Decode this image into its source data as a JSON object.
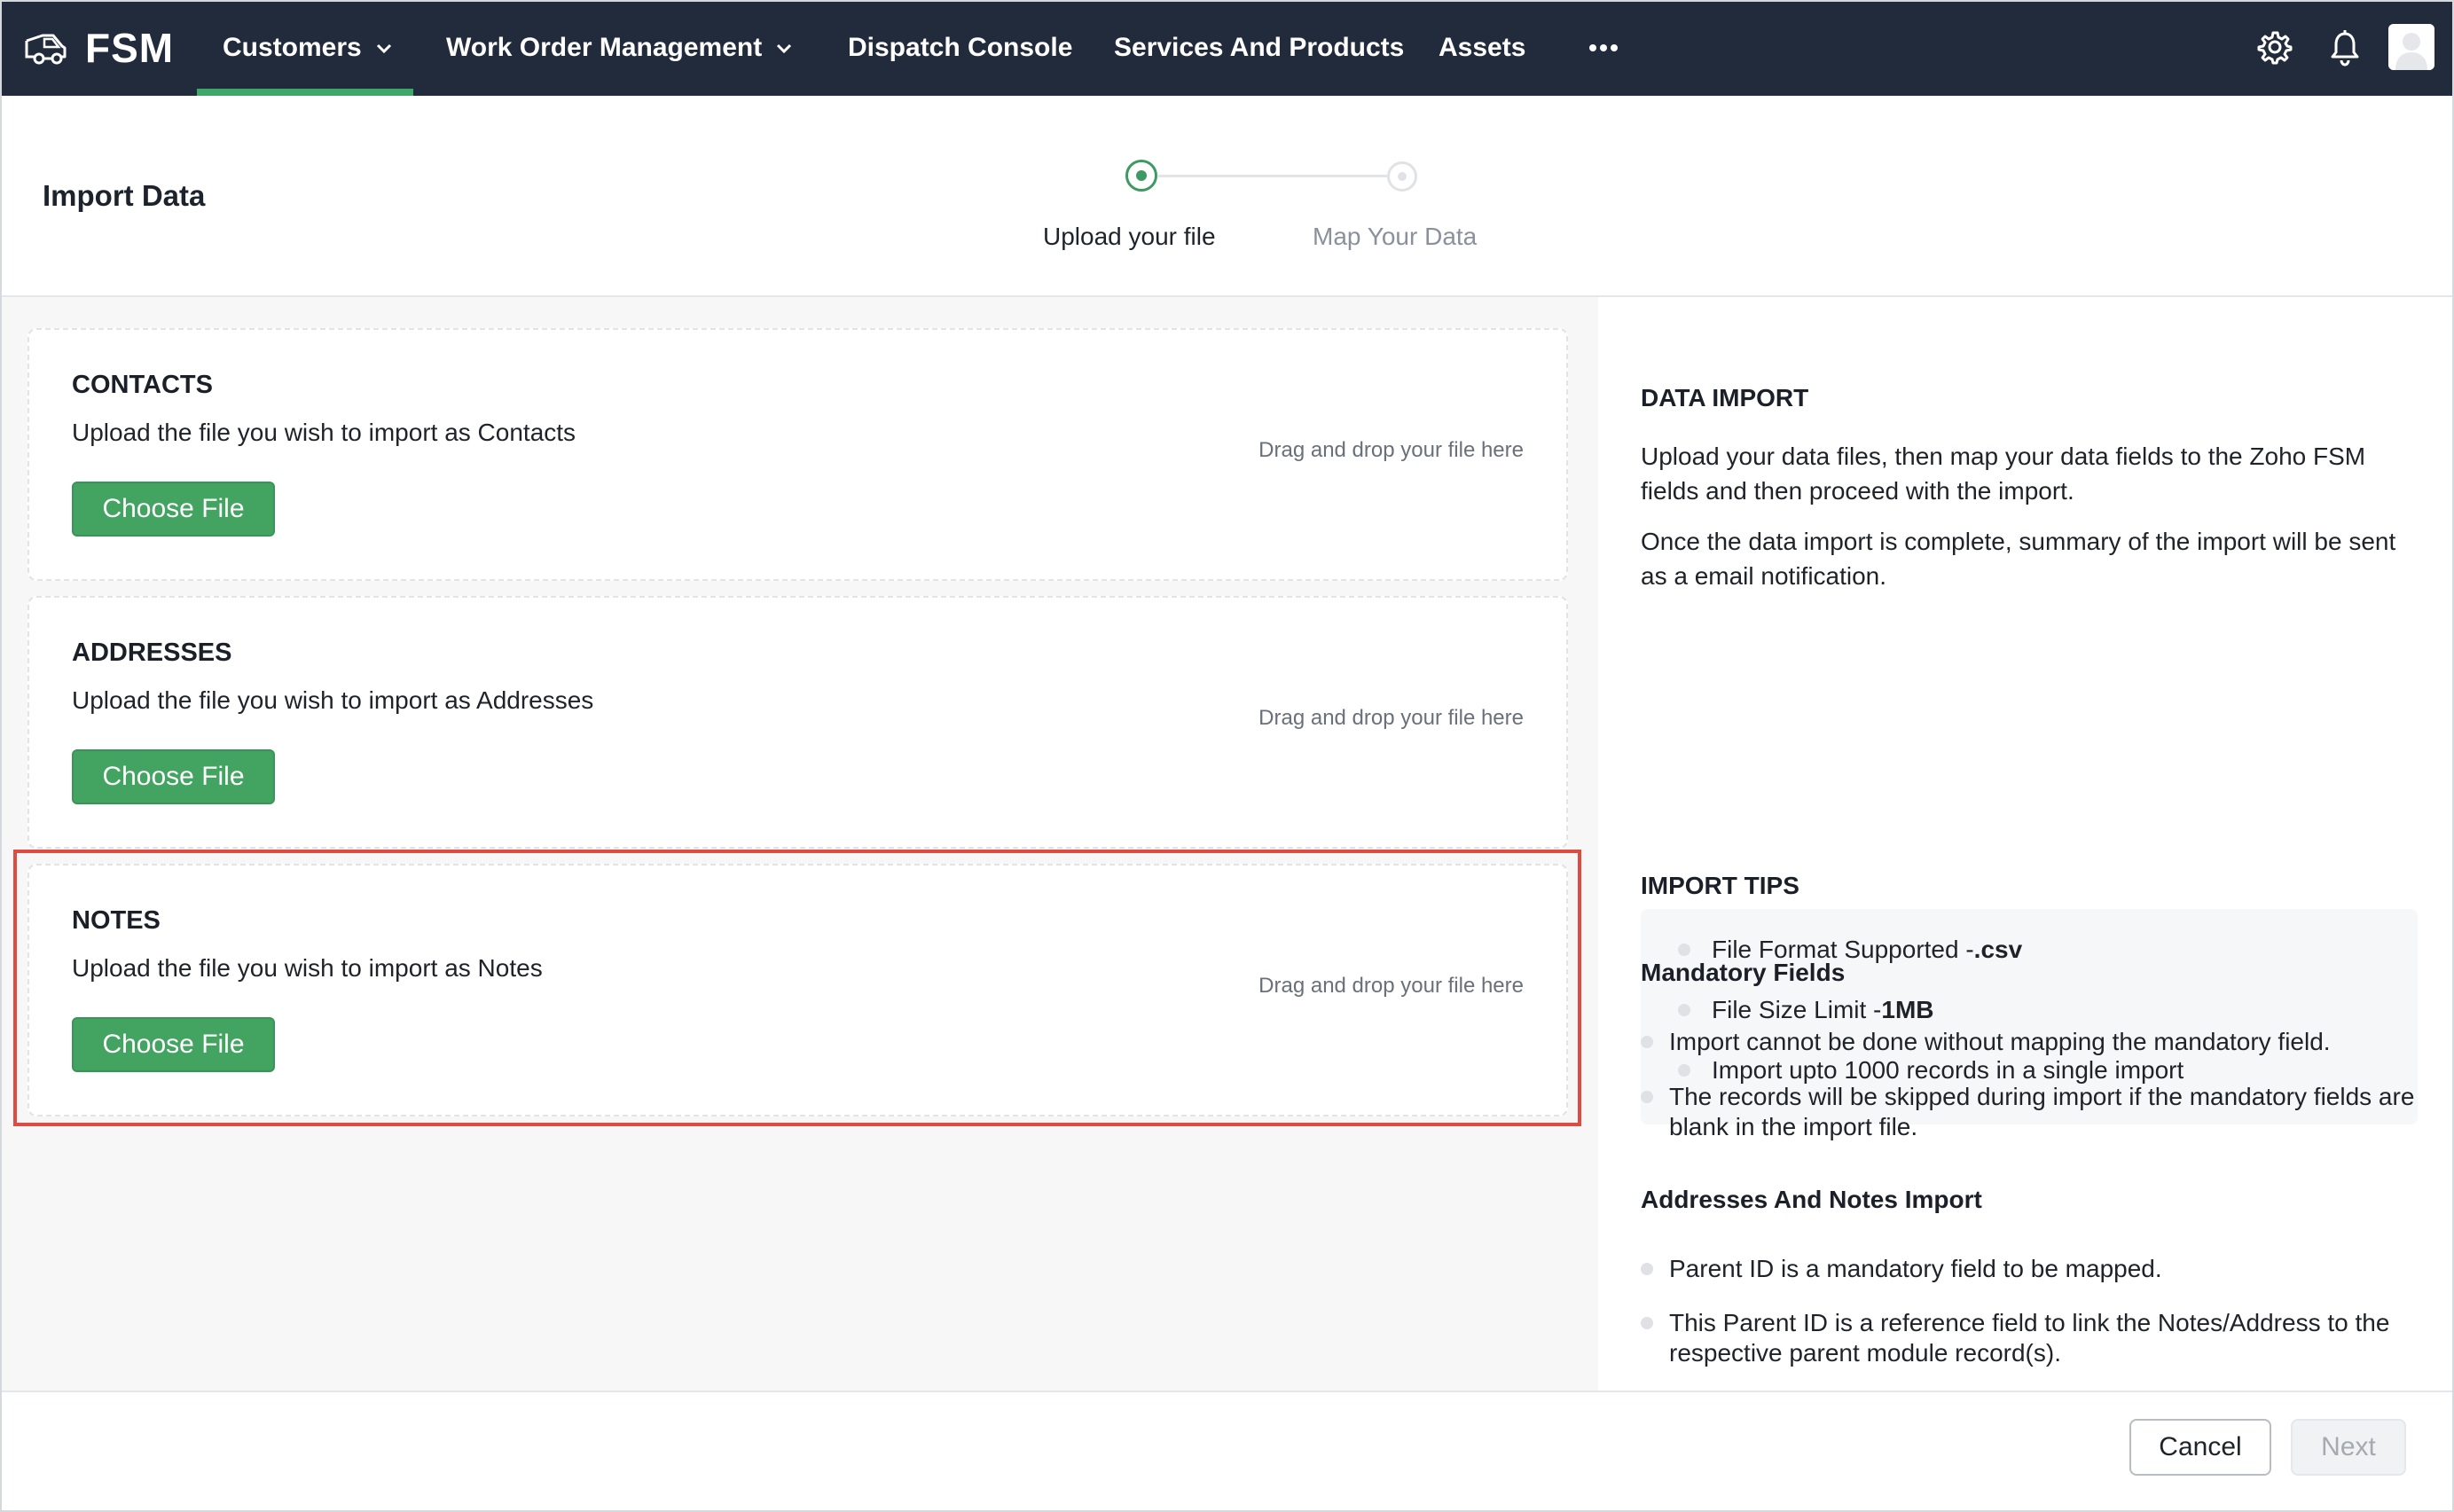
{
  "nav": {
    "brand": "FSM",
    "items": [
      {
        "label": "Customers",
        "has_dropdown": true,
        "active": true
      },
      {
        "label": "Work Order Management",
        "has_dropdown": true,
        "active": false
      },
      {
        "label": "Dispatch Console",
        "has_dropdown": false,
        "active": false
      },
      {
        "label": "Services And Products",
        "has_dropdown": false,
        "active": false
      },
      {
        "label": "Assets",
        "has_dropdown": false,
        "active": false
      }
    ],
    "more_icon": "ellipsis-icon",
    "settings_icon": "gear-icon",
    "notifications_icon": "bell-icon",
    "avatar_icon": "user-avatar",
    "accent_color": "#3fa767"
  },
  "header": {
    "title": "Import Data",
    "steps": [
      {
        "label": "Upload your file",
        "state": "current"
      },
      {
        "label": "Map Your Data",
        "state": "pending"
      }
    ]
  },
  "cards": [
    {
      "title": "CONTACTS",
      "description": "Upload the file you wish to import as Contacts",
      "drop_hint": "Drag and drop your file here",
      "button": "Choose File"
    },
    {
      "title": "ADDRESSES",
      "description": "Upload the file you wish to import as Addresses",
      "drop_hint": "Drag and drop your file here",
      "button": "Choose File"
    },
    {
      "title": "NOTES",
      "description": "Upload the file you wish to import as Notes",
      "drop_hint": "Drag and drop your file here",
      "button": "Choose File",
      "highlighted": true
    }
  ],
  "sidebar": {
    "data_import_heading": "DATA IMPORT",
    "paragraph_1": "Upload your data files, then map your data fields to the Zoho FSM fields and then proceed with the import.",
    "paragraph_2": "Once the data import is complete, summary of the import will be sent as a email notification.",
    "info": [
      {
        "label": "File Format Supported - ",
        "value": ".csv"
      },
      {
        "label": "File Size Limit - ",
        "value": "1MB"
      },
      {
        "label": "Import upto 1000 records in a single import",
        "value": ""
      }
    ],
    "tips_heading": "IMPORT TIPS",
    "mandatory_heading": "Mandatory Fields",
    "mandatory_tips": [
      "Import cannot be done without mapping the mandatory field.",
      "The records will be skipped during import if the mandatory fields are blank in the import file."
    ],
    "addresses_heading": "Addresses And Notes Import",
    "addresses_tips": [
      "Parent ID is a mandatory field to be mapped.",
      "This Parent ID is a reference field to link the Notes/Address to the respective parent module record(s)."
    ]
  },
  "footer": {
    "cancel_label": "Cancel",
    "next_label": "Next",
    "next_enabled": false
  },
  "colors": {
    "nav_background": "#222b3c",
    "primary_button": "#43a462",
    "highlight_border": "#dd4b41"
  }
}
